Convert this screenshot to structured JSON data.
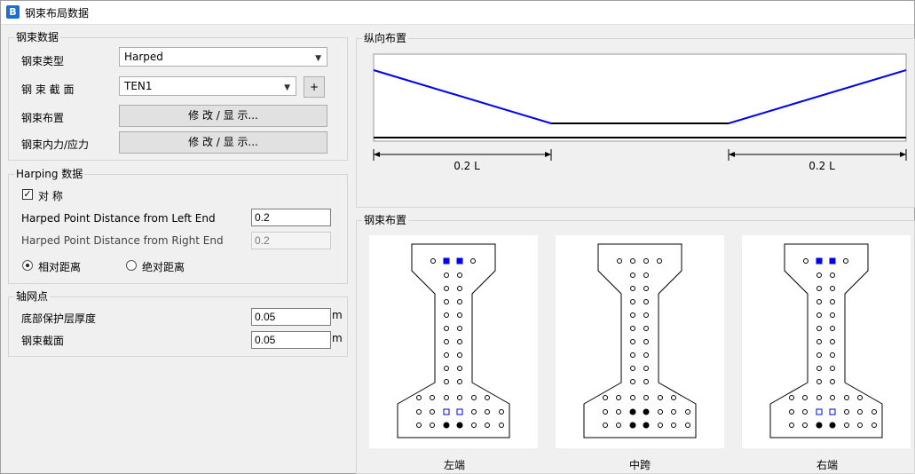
{
  "window": {
    "logo": "B",
    "title": "钢束布局数据"
  },
  "tendon_data": {
    "group_title": "钢束数据",
    "type_label": "钢束类型",
    "type_value": "Harped",
    "section_label": "钢 束 截 面",
    "section_value": "TEN1",
    "add_label": "+",
    "layout_label": "钢束布置",
    "layout_button": "修 改 / 显 示...",
    "force_label": "钢束内力/应力",
    "force_button": "修 改 / 显 示..."
  },
  "harping": {
    "group_title": "Harping 数据",
    "symmetric_label": "对 称",
    "symmetric_checked": true,
    "left_label": "Harped Point Distance from Left End",
    "left_value": "0.2",
    "right_label": "Harped Point Distance from Right End",
    "right_value": "0.2",
    "relative_label": "相对距离",
    "absolute_label": "绝对距离",
    "mode": "relative"
  },
  "grid": {
    "group_title": "轴网点",
    "cover_label": "底部保护层厚度",
    "cover_value": "0.05",
    "cover_unit": "m",
    "section_label": "钢束截面",
    "section_value": "0.05",
    "section_unit": "m"
  },
  "longitudinal": {
    "group_title": "纵向布置",
    "left_dim": "0.2 L",
    "right_dim": "0.2 L",
    "tendon_color": "#0000ee"
  },
  "arrangement": {
    "group_title": "钢束布置",
    "sections": [
      {
        "label": "左端"
      },
      {
        "label": "中跨"
      },
      {
        "label": "右端"
      }
    ]
  }
}
